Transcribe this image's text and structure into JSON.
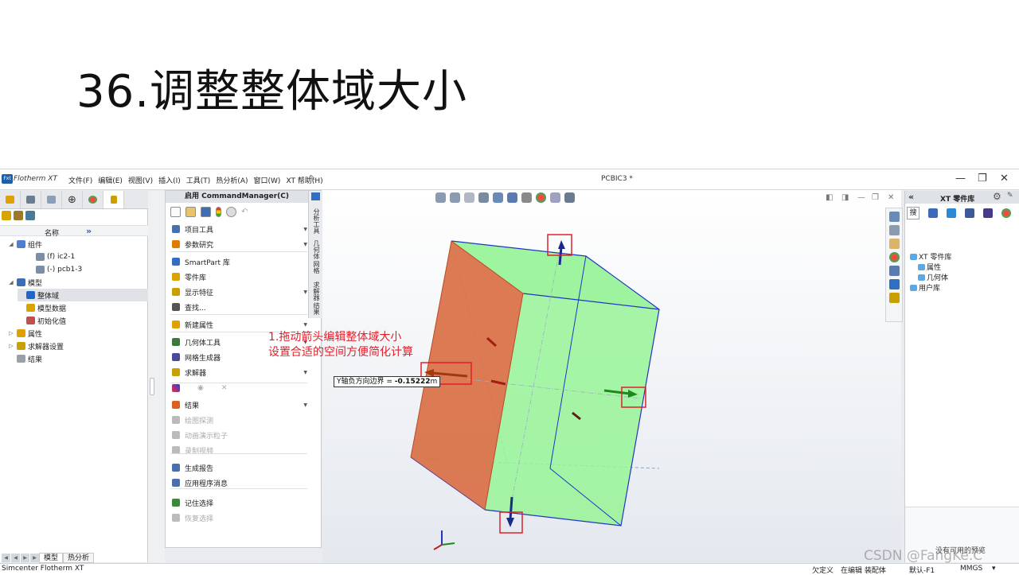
{
  "slide": {
    "title": "36.调整整体域大小"
  },
  "app": {
    "logo": "Fxt",
    "name": "Flotherm XT",
    "menu": [
      "文件(F)",
      "编辑(E)",
      "视图(V)",
      "插入(I)",
      "工具(T)",
      "热分析(A)",
      "窗口(W)",
      "XT 帮助(H)"
    ],
    "doc_title": "PCBIC3 *",
    "window_controls": {
      "minimize": "—",
      "restore": "❐",
      "close": "✕"
    }
  },
  "left_panel": {
    "tree_header": "名称",
    "expand_symbol": "»",
    "tree": [
      {
        "label": "组件",
        "level": 0,
        "twisty": "◢",
        "color": "#4f7fd1"
      },
      {
        "label": "(f) ic2-1",
        "level": 2,
        "twisty": "",
        "color": "#7a8ea8"
      },
      {
        "label": "(-) pcb1-3",
        "level": 2,
        "twisty": "",
        "color": "#7a8ea8"
      },
      {
        "label": "模型",
        "level": 0,
        "twisty": "◢",
        "color": "#3a6fb8"
      },
      {
        "label": "整体域",
        "level": 1,
        "twisty": "",
        "color": "#1e66c8",
        "selected": true
      },
      {
        "label": "模型数据",
        "level": 1,
        "twisty": "",
        "color": "#d9a400"
      },
      {
        "label": "初始化值",
        "level": 1,
        "twisty": "",
        "color": "#c0504d"
      },
      {
        "label": "属性",
        "level": 0,
        "twisty": "▷",
        "color": "#e0a000"
      },
      {
        "label": "求解器设置",
        "level": 0,
        "twisty": "▷",
        "color": "#c9a000"
      },
      {
        "label": "结果",
        "level": 0,
        "twisty": "",
        "color": "#9aa0a8"
      }
    ],
    "bottom_tabs": [
      "模型",
      "热分析"
    ]
  },
  "command_manager": {
    "header": "启用 CommandManager(C)",
    "vertical_tabs": [
      "分析工具",
      "几何体",
      "网格",
      "求解器",
      "结果"
    ],
    "items": [
      {
        "label": "项目工具",
        "arrow": true,
        "color": "#4a6fb0"
      },
      {
        "label": "参数研究",
        "arrow": true,
        "color": "#e07b00"
      },
      {
        "label": "SmartPart 库",
        "arrow": false,
        "color": "#2f6fc4"
      },
      {
        "label": "零件库",
        "arrow": false,
        "color": "#d9a400"
      },
      {
        "label": "显示特征",
        "arrow": true,
        "color": "#c9a000"
      },
      {
        "label": "查找...",
        "arrow": false,
        "color": "#555555"
      },
      {
        "label": "新建属性",
        "arrow": true,
        "color": "#e0a000"
      },
      {
        "label": "几何体工具",
        "arrow": true,
        "color": "#3a7a3a"
      },
      {
        "label": "网格生成器",
        "arrow": false,
        "color": "#4a4a9a"
      },
      {
        "label": "求解器",
        "arrow": true,
        "color": "#c9a000"
      },
      {
        "label": "结果",
        "arrow": true,
        "color": "#e06020"
      },
      {
        "label": "绘图探测",
        "arrow": false,
        "color": "#bbbbbb",
        "disabled": true
      },
      {
        "label": "动画演示粒子",
        "arrow": false,
        "color": "#bbbbbb",
        "disabled": true
      },
      {
        "label": "录制视频",
        "arrow": false,
        "color": "#bbbbbb",
        "disabled": true
      },
      {
        "label": "生成报告",
        "arrow": false,
        "color": "#4a6fb0"
      },
      {
        "label": "应用程序消息",
        "arrow": false,
        "color": "#4a6fb0"
      },
      {
        "label": "记住选择",
        "arrow": false,
        "color": "#3a8a3a"
      },
      {
        "label": "恢复选择",
        "arrow": false,
        "color": "#bbbbbb",
        "disabled": true
      }
    ]
  },
  "viewport": {
    "annotation_line1": "1.拖动箭头编辑整体域大小",
    "annotation_line2": "设置合适的空间方便简化计算",
    "tooltip_label": "Y轴负方向边界 = ",
    "tooltip_value": "-0.15222",
    "tooltip_unit": "m"
  },
  "right_panel": {
    "title": "XT 零件库",
    "search_label": "搜",
    "tree": [
      {
        "label": "XT 零件库",
        "indent": 0
      },
      {
        "label": "属性",
        "indent": 1
      },
      {
        "label": "几何体",
        "indent": 1
      },
      {
        "label": "用户库",
        "indent": 0
      }
    ],
    "preview_text": "没有可用的预览"
  },
  "status": {
    "app": "Simcenter Flotherm XT",
    "underdefined": "欠定义",
    "editing": "在编辑 装配体",
    "units": "默认-F1",
    "unit_system": "MMGS",
    "dropdown": "▾"
  },
  "watermark": "CSDN @FangKe.C",
  "colors": {
    "domain_green": "#8ef28e",
    "domain_red_face": "#d9734a",
    "edge_blue": "#2035c8",
    "annotation_red": "#e0202a"
  }
}
